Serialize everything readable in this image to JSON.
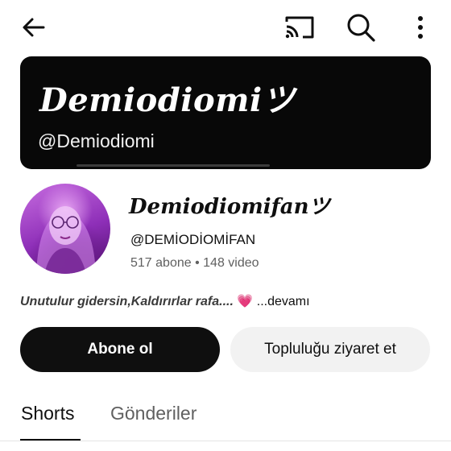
{
  "banner": {
    "title": "Demiodiomiツ",
    "handle": "@Demiodiomi"
  },
  "channel": {
    "name": "Demiodiomifanツ",
    "handle": "@DEMİODİOMİFAN",
    "subscribers": "517 abone",
    "separator": "•",
    "videos": "148 video",
    "description": "Unutulur gidersin,Kaldırırlar rafa....",
    "description_emoji": "💗",
    "more_label": "...devamı"
  },
  "buttons": {
    "subscribe": "Abone ol",
    "community": "Topluluğu ziyaret et"
  },
  "tabs": [
    {
      "label": "Shorts",
      "active": true
    },
    {
      "label": "Gönderiler",
      "active": false
    }
  ],
  "icons": {
    "back": "arrow-left-icon",
    "cast": "cast-icon",
    "search": "search-icon",
    "more": "more-vert-icon"
  },
  "colors": {
    "primary_text": "#0f0f0f",
    "secondary_text": "#606060",
    "subscribe_bg": "#0f0f0f",
    "community_bg": "#f2f2f2",
    "banner_bg": "#080808",
    "avatar_accent": "#b44fd6"
  }
}
